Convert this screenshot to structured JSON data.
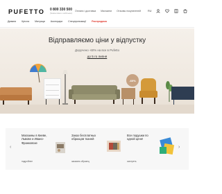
{
  "header": {
    "logo": "PUFETTO",
    "phone": "0 800 330 500",
    "phone_sub": "(безкоштовно з мобільних)",
    "links": [
      "Оплата і доставка",
      "Магазини",
      "Отзывы покупателей"
    ],
    "language": "RU",
    "icons": [
      "user-icon",
      "heart-icon",
      "compare-icon",
      "cart-icon"
    ]
  },
  "nav": {
    "items": [
      "Дивани",
      "Крісла",
      "Матраци",
      "Аксесуари",
      "Спецпропозиції"
    ],
    "hot_item": "Распродажа"
  },
  "hero": {
    "title": "Відправляємо ціни у відпустку",
    "subtitle": "Доручено -60% на все в Pufetto",
    "link": "до 5 го липня",
    "badge": "-60%",
    "colors": {
      "background": "#f4efe8",
      "sofa_left": "#c98a52",
      "sofa_center": "#8e8b6a",
      "armchair": "#d49a3a",
      "cabinet": "#2e3d52"
    }
  },
  "promo": {
    "cards": [
      {
        "title": "Магазины в Киеве, Львове и Ивано-Франковске",
        "link": "подробнее"
      },
      {
        "title": "Заказ бесплатных образцов тканей",
        "link": "заказать образец"
      },
      {
        "title": "Все подушки по одной цене!",
        "link": "смотреть"
      }
    ],
    "arrow_left": "‹",
    "arrow_right": "›"
  }
}
